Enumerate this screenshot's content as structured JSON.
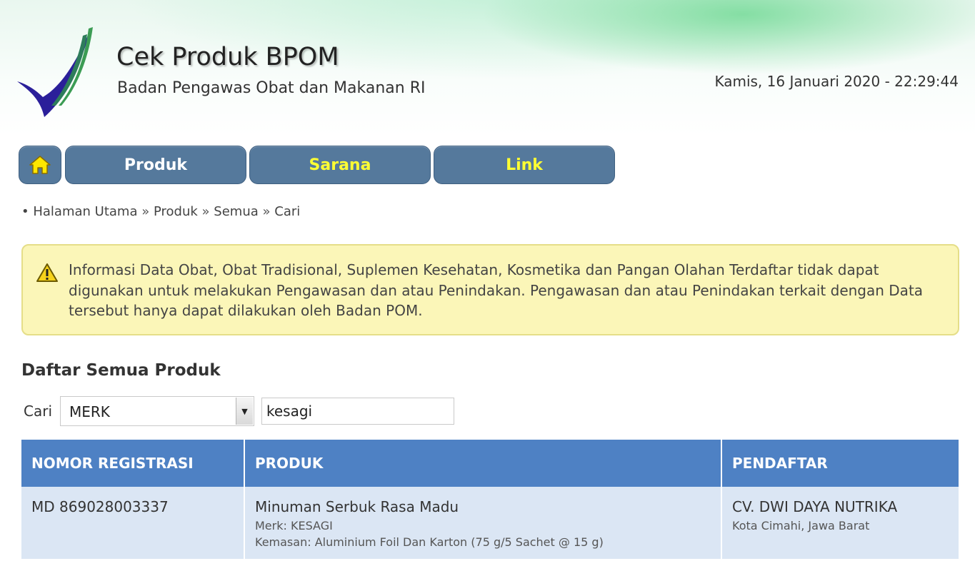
{
  "header": {
    "title": "Cek Produk BPOM",
    "subtitle": "Badan Pengawas Obat dan Makanan RI",
    "datetime": "Kamis, 16 Januari 2020 - 22:29:44",
    "logo_icon": "bpom-checkmark-logo"
  },
  "nav": {
    "home_icon": "home-icon",
    "items": [
      {
        "label": "Produk",
        "color": "#ffffff"
      },
      {
        "label": "Sarana",
        "color": "#ffff33"
      },
      {
        "label": "Link",
        "color": "#ffff33"
      }
    ],
    "button_color": "#55799c"
  },
  "breadcrumb": {
    "items": [
      "Halaman Utama",
      "Produk",
      "Semua",
      "Cari"
    ],
    "separator": "»"
  },
  "notice": {
    "icon": "warning-icon",
    "text": "Informasi Data Obat, Obat Tradisional, Suplemen Kesehatan, Kosmetika dan Pangan Olahan Terdaftar tidak dapat digunakan untuk melakukan Pengawasan dan atau Penindakan. Pengawasan dan atau Penindakan terkait dengan Data tersebut hanya dapat dilakukan oleh Badan POM.",
    "background": "#fbf6b8"
  },
  "section": {
    "title": "Daftar Semua Produk"
  },
  "search": {
    "label": "Cari",
    "select_value": "MERK",
    "input_value": "kesagi"
  },
  "table": {
    "header_color": "#4e81c4",
    "row_color": "#dbe6f4",
    "columns": [
      "NOMOR REGISTRASI",
      "PRODUK",
      "PENDAFTAR"
    ],
    "rows": [
      {
        "nomor": "MD 869028003337",
        "produk": "Minuman Serbuk Rasa Madu",
        "merk": "Merk: KESAGI",
        "kemasan": "Kemasan: Aluminium Foil Dan Karton (75 g/5 Sachet @ 15 g)",
        "pendaftar": "CV. DWI DAYA NUTRIKA",
        "lokasi": "Kota Cimahi, Jawa Barat"
      }
    ]
  }
}
